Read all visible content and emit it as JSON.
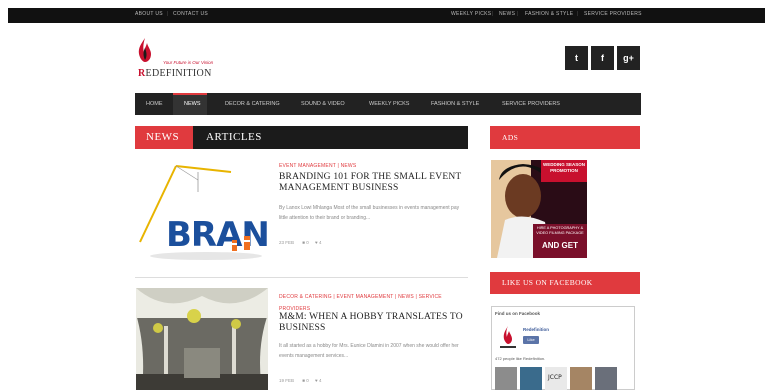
{
  "topbar": {
    "left_links": [
      "ABOUT US",
      "CONTACT US"
    ],
    "right_links": [
      "WEEKLY PICKS",
      "NEWS",
      "FASHION & STYLE",
      "SERVICE PROVIDERS"
    ]
  },
  "logo": {
    "tagline": "Your Future is Our Vision",
    "brand_first": "R",
    "brand_rest": "EDEFINITION"
  },
  "social": [
    {
      "icon": "twitter-icon",
      "glyph": "t"
    },
    {
      "icon": "facebook-icon",
      "glyph": "f"
    },
    {
      "icon": "google-plus-icon",
      "glyph": "g+"
    }
  ],
  "nav": {
    "items": [
      "HOME",
      "NEWS",
      "DECOR & CATERING",
      "SOUND & VIDEO",
      "WEEKLY PICKS",
      "FASHION & STYLE",
      "SERVICE PROVIDERS"
    ],
    "active": "NEWS"
  },
  "section": {
    "tag": "NEWS",
    "title": "ARTICLES"
  },
  "articles": [
    {
      "categories": "EVENT MANAGEMENT  |  NEWS",
      "title": "BRANDING 101 FOR THE SMALL EVENT MANAGEMENT BUSINESS",
      "excerpt": "By Lanox Lowi Mhlanga Most of the small businesses in events management pay little attention to their brand or branding...",
      "date": "23 FEB",
      "comments": "0",
      "likes": "4",
      "thumb_word": "BRAND"
    },
    {
      "categories": "DECOR & CATERING  |  EVENT MANAGEMENT  |  NEWS  |  SERVICE PROVIDERS",
      "title": "M&M: WHEN A HOBBY TRANSLATES TO BUSINESS",
      "excerpt": "It all started as a hobby for Mrs. Eunice Dlamini in 2007 when she would offer her events management services...",
      "date": "19 FEB",
      "comments": "0",
      "likes": "4"
    }
  ],
  "sidebar": {
    "ads_title": "ADS",
    "ad": {
      "headline": "WEDDING SEASON PROMOTION",
      "body": "HIRE A PHOTOGRAPHY & VIDEO FILMING PACKAGE",
      "cta": "AND GET"
    },
    "facebook_title": "LIKE US ON FACEBOOK",
    "fb_widget": {
      "find_us": "Find us on Facebook",
      "page_name": "Redefinition",
      "like_label": "Like",
      "likes_text": "472 people like Redefinition."
    }
  },
  "colors": {
    "accent": "#e03a3e",
    "dark": "#1b1b1b",
    "facebook": "#3b5998"
  }
}
